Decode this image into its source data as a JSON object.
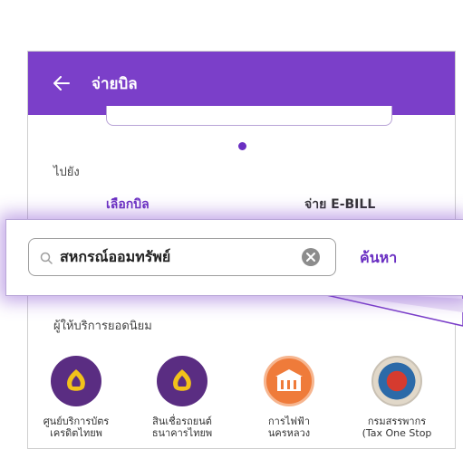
{
  "header": {
    "title": "จ่ายบิล"
  },
  "section": {
    "goto_label": "ไปยัง"
  },
  "tabs": [
    {
      "label": "เลือกบิล",
      "active": true
    },
    {
      "label": "จ่าย E-BILL",
      "active": false
    }
  ],
  "search": {
    "value": "สหกรณ์ออมทรัพย์",
    "button_label": "ค้นหา"
  },
  "popular": {
    "title": "ผู้ให้บริการยอดนิยม",
    "providers": [
      {
        "line1": "ศูนย์บริการบัตร",
        "line2": "เครดิตไทยพ",
        "icon": "bank-logo-icon"
      },
      {
        "line1": "สินเชื่อรถยนต์",
        "line2": "ธนาคารไทยพ",
        "icon": "bank-logo-icon"
      },
      {
        "line1": "การไฟฟ้า",
        "line2": "นครหลวง",
        "icon": "electricity-authority-logo-icon"
      },
      {
        "line1": "กรมสรรพากร",
        "line2": "(Tax One Stop",
        "icon": "revenue-department-logo-icon"
      }
    ]
  },
  "colors": {
    "brand": "#7b3fc9",
    "accent": "#6a2fc2",
    "provider_bank": "#5a2d82",
    "provider_mea": "#ef7b3a"
  }
}
